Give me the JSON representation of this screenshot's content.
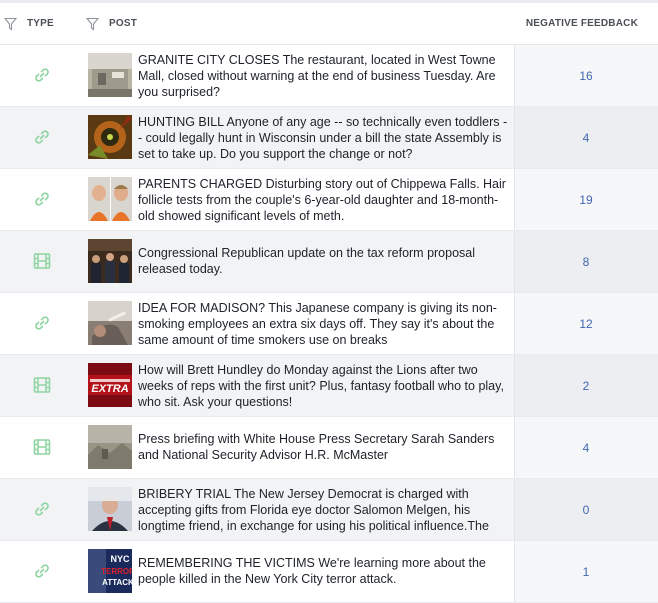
{
  "header": {
    "type_label": "TYPE",
    "post_label": "POST",
    "negative_label": "NEGATIVE FEEDBACK"
  },
  "colors": {
    "link_icon": "#8ed4a0",
    "video_icon": "#8ed4a0",
    "value_blue": "#4267b2"
  },
  "rows": [
    {
      "type_icon": "link-icon",
      "text": "GRANITE CITY CLOSES The restaurant, located in West Towne Mall, closed without warning at the end of business Tuesday. Are you surprised?",
      "negative_feedback": "16"
    },
    {
      "type_icon": "link-icon",
      "text": "HUNTING BILL Anyone of any age -- so technically even toddlers -- could legally hunt in Wisconsin under a bill the state Assembly is set to take up. Do you support the change or not?",
      "negative_feedback": "4"
    },
    {
      "type_icon": "link-icon",
      "text": "PARENTS CHARGED Disturbing story out of Chippewa Falls. Hair follicle tests from the couple's 6-year-old daughter and 18-month-old showed significant levels of meth.",
      "negative_feedback": "19"
    },
    {
      "type_icon": "video-icon",
      "text": "Congressional Republican update on the tax reform proposal released today.",
      "negative_feedback": "8"
    },
    {
      "type_icon": "link-icon",
      "text": "IDEA FOR MADISON? This Japanese company is giving its non-smoking employees an extra six days off. They say it's about the same amount of time smokers use on breaks",
      "negative_feedback": "12"
    },
    {
      "type_icon": "video-icon",
      "text": "How will Brett Hundley do Monday against the Lions after two weeks of reps with the first unit? Plus, fantasy football who to play, who sit. Ask your questions!",
      "negative_feedback": "2"
    },
    {
      "type_icon": "video-icon",
      "text": "Press briefing with White House Press Secretary Sarah Sanders and National Security Advisor H.R. McMaster",
      "negative_feedback": "4"
    },
    {
      "type_icon": "link-icon",
      "text": "BRIBERY TRIAL The New Jersey Democrat is charged with accepting gifts from Florida eye doctor Salomon Melgen, his longtime friend, in exchange for using his political influence.The",
      "negative_feedback": "0"
    },
    {
      "type_icon": "link-icon",
      "text": "REMEMBERING THE VICTIMS We're learning more about the people killed in the New York City terror attack.",
      "negative_feedback": "1"
    }
  ],
  "thumb_overlay_texts": {
    "row6": "EXTRA",
    "row9_a": "NYC",
    "row9_b": "TERROR",
    "row9_c": "ATTACK"
  }
}
